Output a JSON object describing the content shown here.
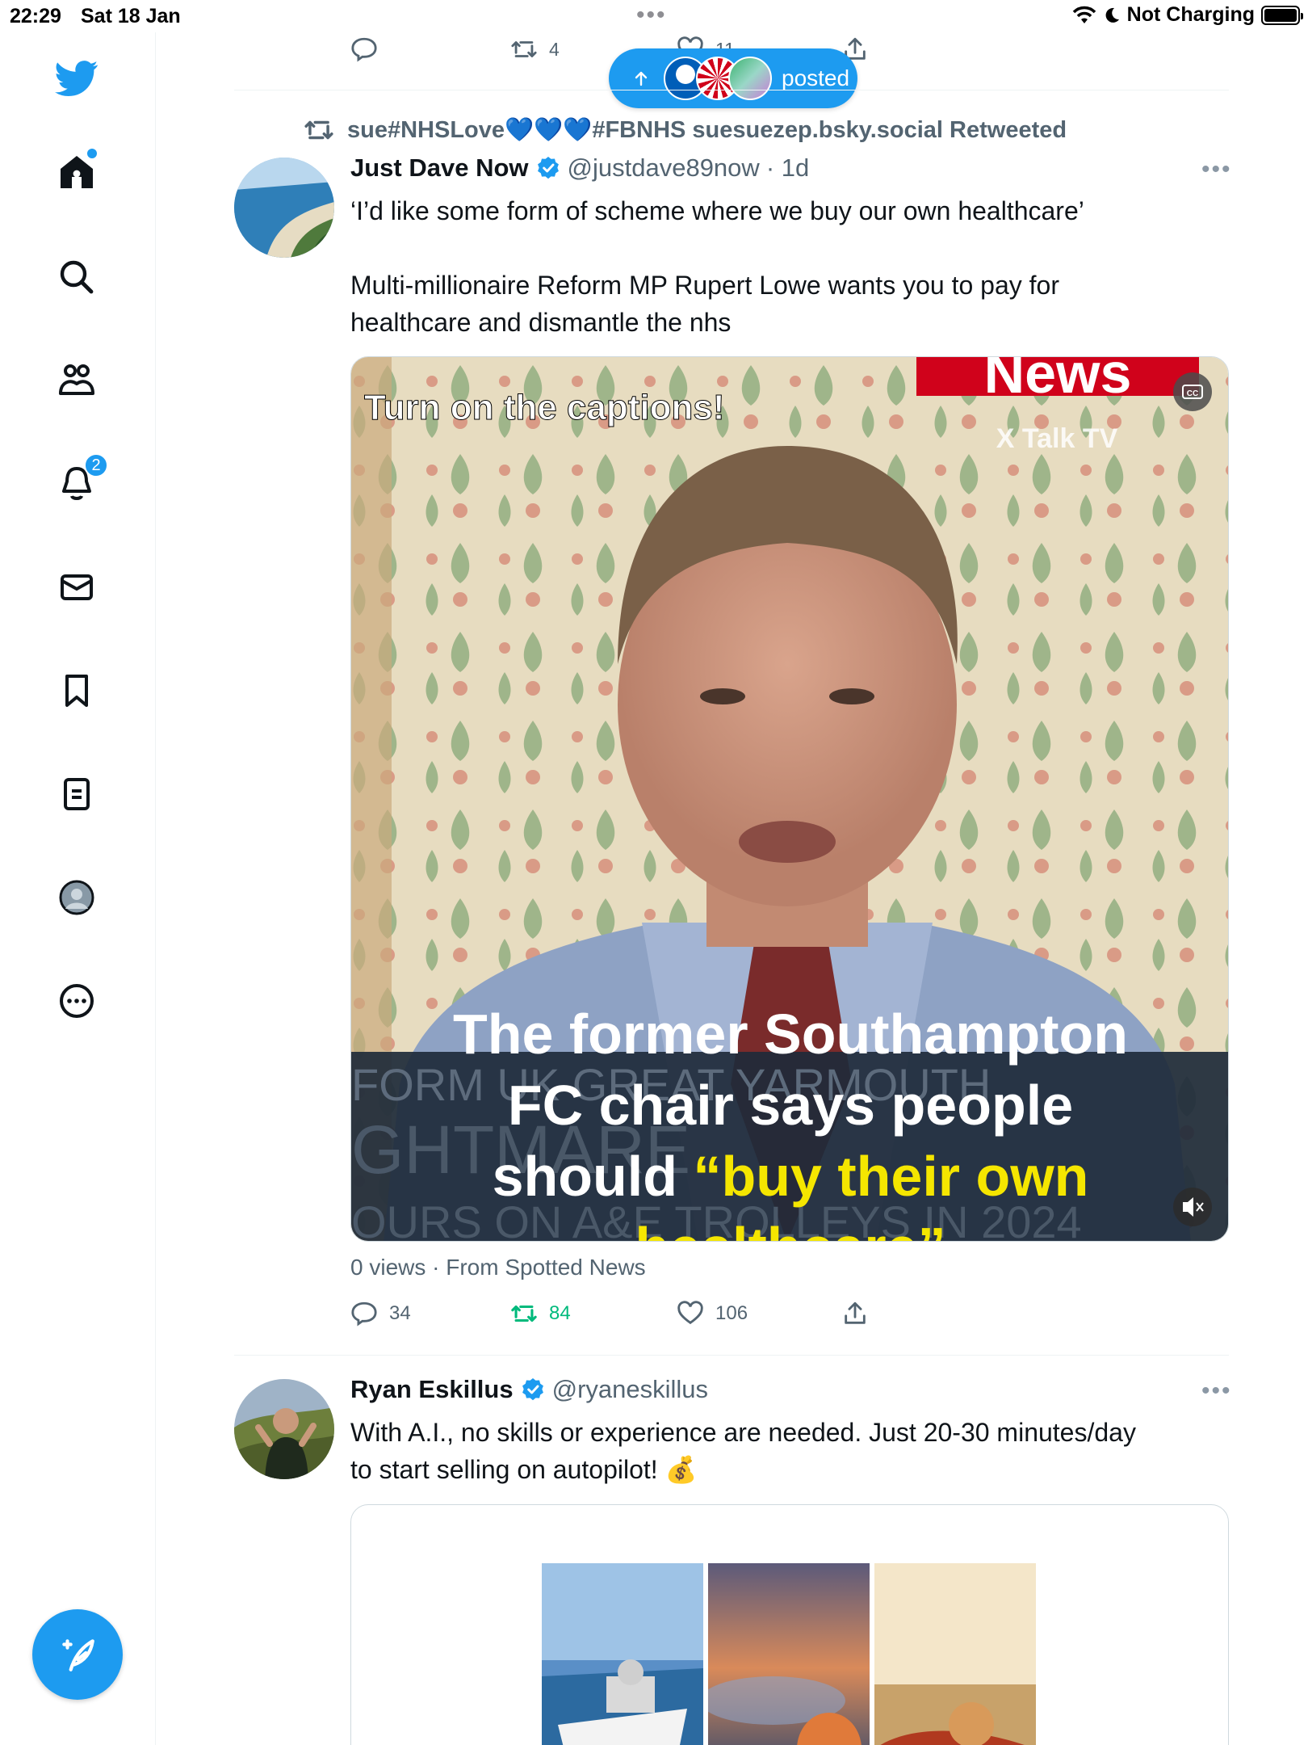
{
  "status_bar": {
    "time": "22:29",
    "date": "Sat 18 Jan",
    "charging": "Not Charging"
  },
  "sidebar": {
    "items": [
      {
        "name": "home",
        "icon": "home-icon"
      },
      {
        "name": "search",
        "icon": "search-icon"
      },
      {
        "name": "communities",
        "icon": "people-icon"
      },
      {
        "name": "notifications",
        "icon": "bell-icon",
        "badge": "2"
      },
      {
        "name": "messages",
        "icon": "mail-icon"
      },
      {
        "name": "bookmarks",
        "icon": "bookmark-icon"
      },
      {
        "name": "lists",
        "icon": "list-icon"
      },
      {
        "name": "profile",
        "icon": "avatar-icon"
      },
      {
        "name": "more",
        "icon": "more-circle-icon"
      }
    ],
    "accent": "#1d9bf0"
  },
  "top_actions": {
    "retweets": "4",
    "likes": "11"
  },
  "new_posts_pill": {
    "label": "posted"
  },
  "tweet1": {
    "retweeted_by": "sue#NHSLove💙💙💙#FBNHS suesuezep.bsky.social Retweeted",
    "name": "Just Dave Now",
    "handle": "@justdave89now",
    "time": "· 1d",
    "text_line1": "‘I’d like some form of scheme where we buy our own healthcare’",
    "text_para2_line1": "Multi-millionaire Reform MP Rupert Lowe wants you to pay for",
    "text_para2_line2": "healthcare and dismantle the nhs",
    "video": {
      "overlay_top": "Turn on the captions!",
      "brand_banner": "News",
      "brand_sub": "X Talk TV",
      "caption_line1": "The former Southampton",
      "caption_line2": "FC chair says people",
      "caption_line3_white": "should ",
      "caption_line3_yellow": "“buy their own",
      "caption_line4_yellow": "healthcare”",
      "bg_text_1": "FORM UK GREAT YARMOUTH",
      "bg_text_2": "GHTMARE",
      "bg_text_3": "OURS ON A&E TROLLEYS IN 2024"
    },
    "meta": "0 views · From Spotted News",
    "replies": "34",
    "retweets": "84",
    "likes": "106"
  },
  "tweet2": {
    "name": "Ryan Eskillus",
    "handle": "@ryaneskillus",
    "text_line1": "With A.I., no skills or experience are needed. Just 20-30 minutes/day",
    "text_line2": "to start selling on autopilot! 💰"
  },
  "colors": {
    "accent": "#1d9bf0",
    "retweet_green": "#00ba7c",
    "secondary_text": "#536471",
    "caption_yellow": "#f5e600"
  }
}
